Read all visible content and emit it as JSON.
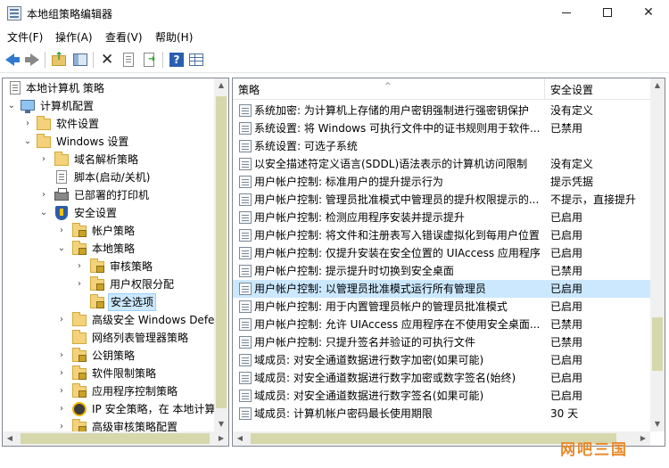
{
  "window": {
    "title": "本地组策略编辑器",
    "minimize_icon": "minimize-icon",
    "maximize_icon": "maximize-icon",
    "close_glyph": "✕"
  },
  "menu": [
    {
      "label": "文件(F)"
    },
    {
      "label": "操作(A)"
    },
    {
      "label": "查看(V)"
    },
    {
      "label": "帮助(H)"
    }
  ],
  "toolbar": {
    "icons": [
      "back-icon",
      "forward-icon",
      "up-folder-icon",
      "show-hide-tree-icon",
      "delete-icon",
      "properties-icon",
      "export-list-icon",
      "help-icon",
      "view-icon"
    ],
    "delete_glyph": "✕",
    "help_glyph": "?"
  },
  "tree": {
    "items": [
      {
        "label": "本地计算机 策略",
        "icon": "policy-icon",
        "expander": ""
      },
      {
        "label": "计算机配置",
        "icon": "computer-icon",
        "expander": "⌄"
      },
      {
        "label": "软件设置",
        "icon": "folder-icon",
        "expander": "›"
      },
      {
        "label": "Windows 设置",
        "icon": "folder-icon",
        "expander": "⌄"
      },
      {
        "label": "域名解析策略",
        "icon": "folder-icon",
        "expander": "›"
      },
      {
        "label": "脚本(启动/关机)",
        "icon": "script-icon",
        "expander": ""
      },
      {
        "label": "已部署的打印机",
        "icon": "printer-icon",
        "expander": "›"
      },
      {
        "label": "安全设置",
        "icon": "security-icon",
        "expander": "⌄"
      },
      {
        "label": "帐户策略",
        "icon": "folder-lock-icon",
        "expander": "›"
      },
      {
        "label": "本地策略",
        "icon": "folder-lock-icon",
        "expander": "⌄"
      },
      {
        "label": "审核策略",
        "icon": "folder-lock-icon",
        "expander": "›"
      },
      {
        "label": "用户权限分配",
        "icon": "folder-lock-icon",
        "expander": "›"
      },
      {
        "label": "安全选项",
        "icon": "folder-lock-icon",
        "expander": ""
      },
      {
        "label": "高级安全 Windows Defe",
        "icon": "folder-icon",
        "expander": "›"
      },
      {
        "label": "网络列表管理器策略",
        "icon": "folder-icon",
        "expander": ""
      },
      {
        "label": "公钥策略",
        "icon": "folder-lock-icon",
        "expander": "›"
      },
      {
        "label": "软件限制策略",
        "icon": "folder-lock-icon",
        "expander": "›"
      },
      {
        "label": "应用程序控制策略",
        "icon": "folder-lock-icon",
        "expander": "›"
      },
      {
        "label": "IP 安全策略，在 本地计算",
        "icon": "ipsec-icon",
        "expander": "›"
      },
      {
        "label": "高级审核策略配置",
        "icon": "folder-lock-icon",
        "expander": "›"
      }
    ]
  },
  "list": {
    "columns": {
      "policy": "策略",
      "setting": "安全设置"
    },
    "sort_glyph": "^",
    "rows": [
      {
        "policy": "系统加密: 为计算机上存储的用户密钥强制进行强密钥保护",
        "setting": "没有定义"
      },
      {
        "policy": "系统设置: 将 Windows 可执行文件中的证书规则用于软件...",
        "setting": "已禁用"
      },
      {
        "policy": "系统设置: 可选子系统",
        "setting": ""
      },
      {
        "policy": "以安全描述符定义语言(SDDL)语法表示的计算机访问限制",
        "setting": "没有定义"
      },
      {
        "policy": "用户帐户控制: 标准用户的提升提示行为",
        "setting": "提示凭据"
      },
      {
        "policy": "用户帐户控制: 管理员批准模式中管理员的提升权限提示的...",
        "setting": "不提示，直接提升"
      },
      {
        "policy": "用户帐户控制: 检测应用程序安装并提示提升",
        "setting": "已启用"
      },
      {
        "policy": "用户帐户控制: 将文件和注册表写入错误虚拟化到每用户位置",
        "setting": "已启用"
      },
      {
        "policy": "用户帐户控制: 仅提升安装在安全位置的 UIAccess 应用程序",
        "setting": "已启用"
      },
      {
        "policy": "用户帐户控制: 提示提升时切换到安全桌面",
        "setting": "已禁用"
      },
      {
        "policy": "用户帐户控制: 以管理员批准模式运行所有管理员",
        "setting": "已启用"
      },
      {
        "policy": "用户帐户控制: 用于内置管理员帐户的管理员批准模式",
        "setting": "已启用"
      },
      {
        "policy": "用户帐户控制: 允许 UIAccess 应用程序在不使用安全桌面...",
        "setting": "已禁用"
      },
      {
        "policy": "用户帐户控制: 只提升签名并验证的可执行文件",
        "setting": "已禁用"
      },
      {
        "policy": "域成员: 对安全通道数据进行数字加密(如果可能)",
        "setting": "已启用"
      },
      {
        "policy": "域成员: 对安全通道数据进行数字加密或数字签名(始终)",
        "setting": "已启用"
      },
      {
        "policy": "域成员: 对安全通道数据进行数字签名(如果可能)",
        "setting": "已启用"
      },
      {
        "policy": "域成员: 计算机帐户密码最长使用期限",
        "setting": "30 天"
      }
    ]
  },
  "watermark": "网吧三国",
  "colors": {
    "selection": "#cce8ff",
    "scroll_thumb": "#d6d8ab",
    "watermark": "#e98a2b"
  }
}
